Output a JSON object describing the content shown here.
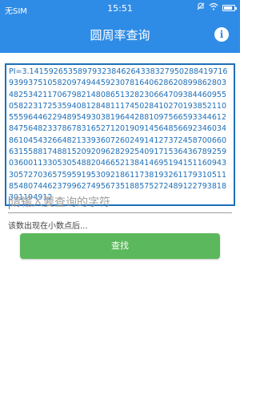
{
  "status_bar": {
    "carrier": "无SIM",
    "time": "15:51",
    "battery_level": 0.85
  },
  "header": {
    "title": "圆周率查询",
    "info_icon_glyph": "i",
    "color": "#2f8ce6"
  },
  "pi_display": {
    "text": "PI=3.14159265358979323846264338327950288419716939937510582097494459230781640628620899862803482534211706798214808651328230664709384460955058223172535940812848111745028410270193852110555964462294895493038196442881097566593344612847564823378678316527120190914564856692346034861045432664821339360726024914127372458700660631558817488152092096282925409171536436789259036001133053054882046652138414695194151160943305727036575959195309218611738193261179310511854807446237996274956735188575272489122793818301194912"
  },
  "search": {
    "placeholder": "请输入要查询的字符",
    "value": ""
  },
  "result": {
    "text": "该数出现在小数点后..."
  },
  "actions": {
    "search_label": "查找",
    "search_color": "#5cb85c"
  }
}
